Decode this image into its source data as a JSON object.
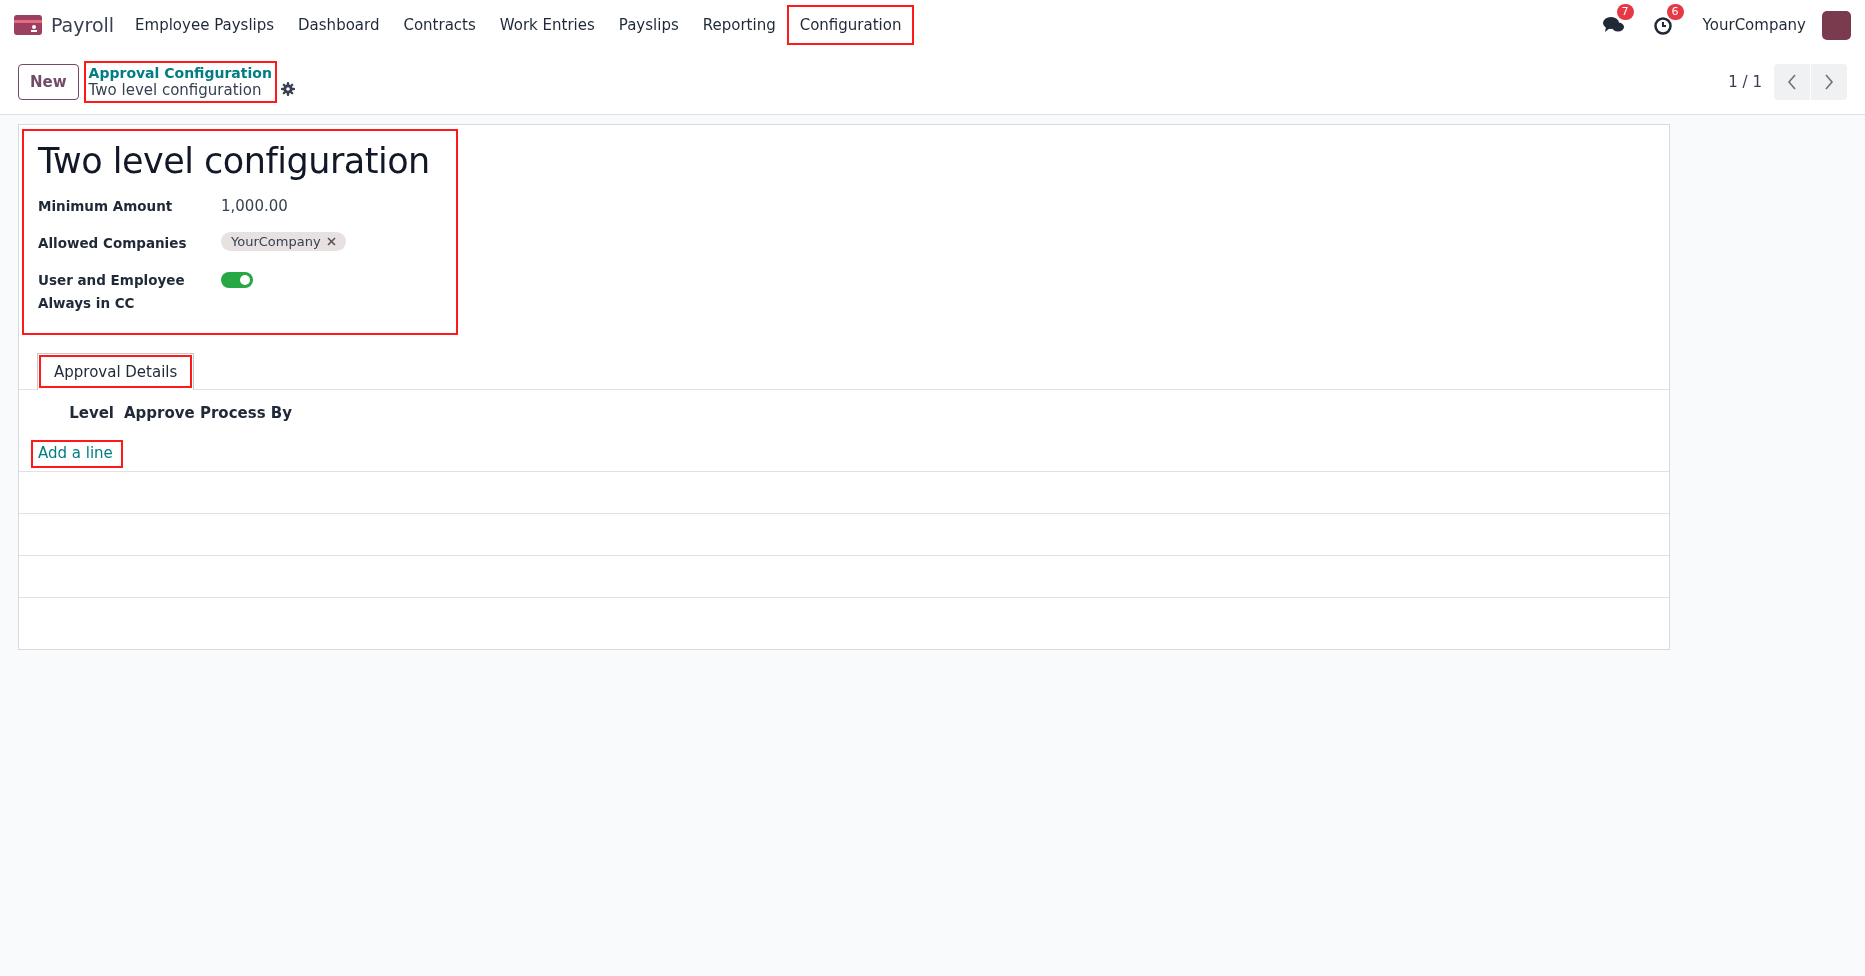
{
  "navbar": {
    "app_name": "Payroll",
    "menu": [
      {
        "label": "Employee Payslips",
        "highlighted": false
      },
      {
        "label": "Dashboard",
        "highlighted": false
      },
      {
        "label": "Contracts",
        "highlighted": false
      },
      {
        "label": "Work Entries",
        "highlighted": false
      },
      {
        "label": "Payslips",
        "highlighted": false
      },
      {
        "label": "Reporting",
        "highlighted": false
      },
      {
        "label": "Configuration",
        "highlighted": true
      }
    ],
    "messages_badge": "7",
    "activities_badge": "6",
    "company": "YourCompany"
  },
  "control_panel": {
    "new_button": "New",
    "breadcrumb": {
      "parent": "Approval Configuration",
      "current": "Two level configuration",
      "highlighted": true
    },
    "pager": "1 / 1"
  },
  "form": {
    "title": "Two level configuration",
    "header_highlighted": true,
    "fields": [
      {
        "kind": "text",
        "label": "Minimum Amount",
        "value": "1,000.00"
      },
      {
        "kind": "tags",
        "label": "Allowed Companies",
        "tags": [
          "YourCompany"
        ]
      },
      {
        "kind": "toggle",
        "label": "User and Employee Always in CC",
        "on": true
      }
    ],
    "tabs": [
      {
        "label": "Approval Details",
        "selected": true,
        "highlighted": true
      }
    ],
    "table": {
      "columns": [
        "Level",
        "Approve Process By"
      ],
      "add_line": "Add a line",
      "add_line_highlighted": true
    }
  }
}
